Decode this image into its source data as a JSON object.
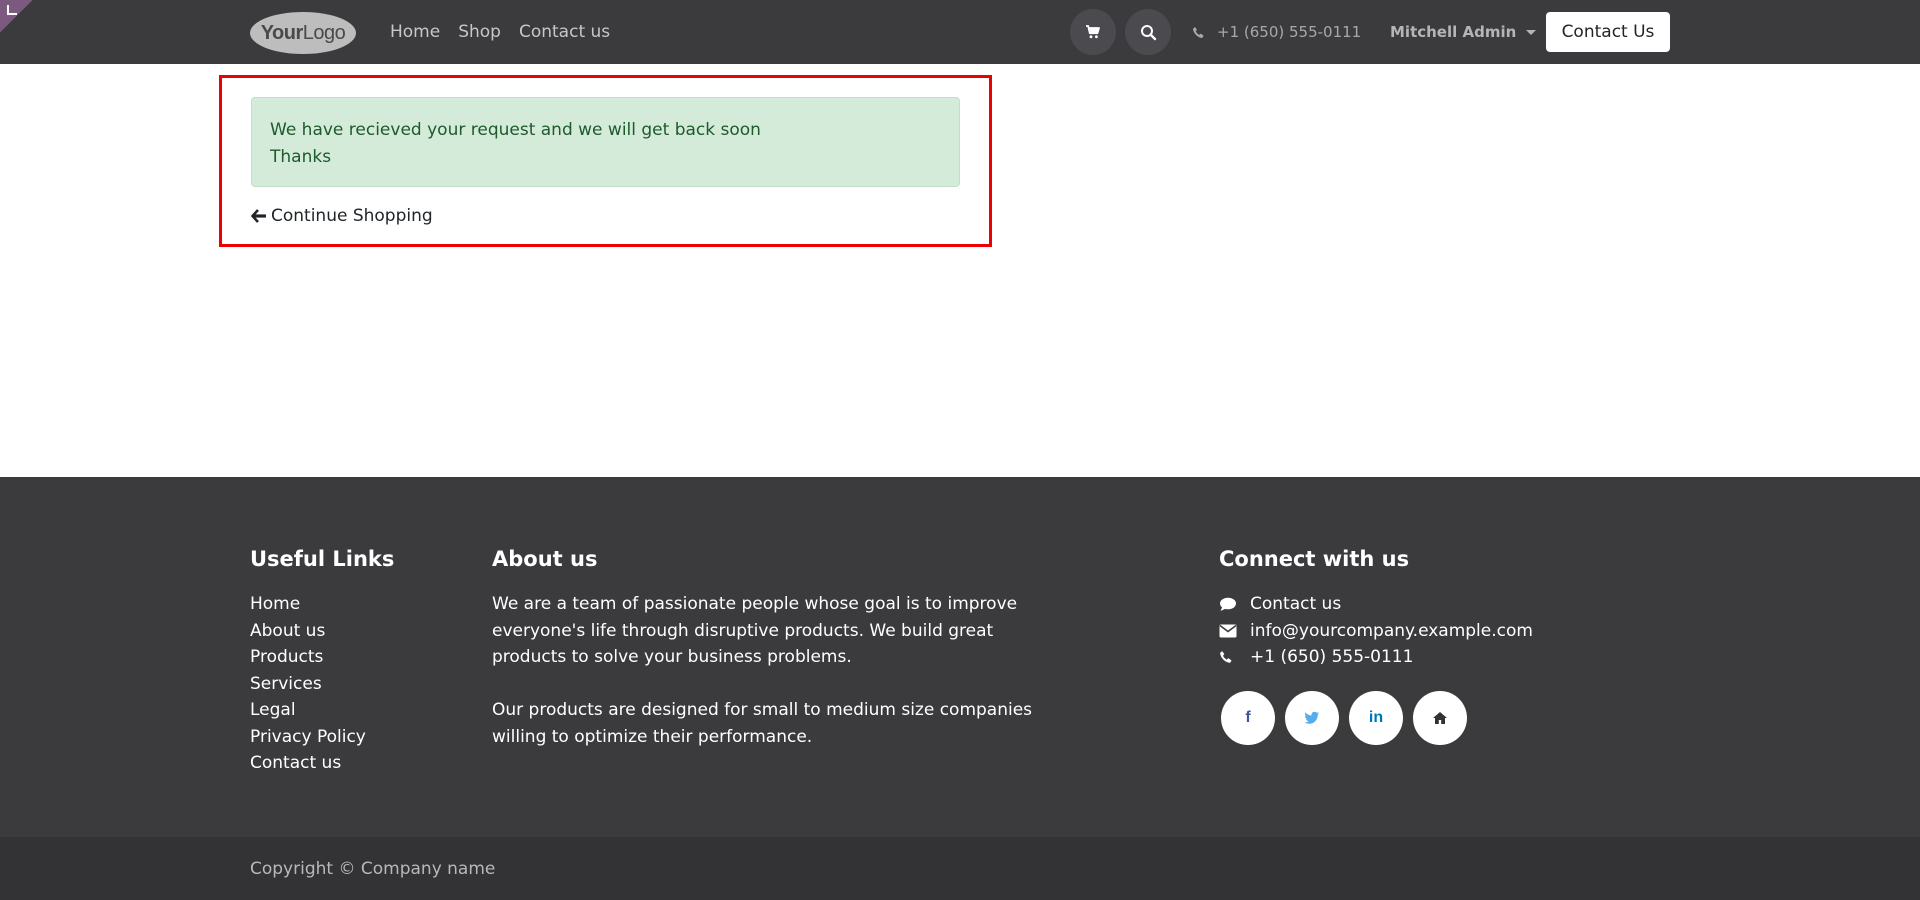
{
  "header": {
    "logo": {
      "part1": "Your",
      "part2": "Logo"
    },
    "nav": [
      {
        "label": "Home"
      },
      {
        "label": "Shop"
      },
      {
        "label": "Contact us"
      }
    ],
    "phone": "+1 (650) 555-0111",
    "user": "Mitchell Admin",
    "cta_label": "Contact Us"
  },
  "main": {
    "alert_line1": "We have recieved your request and we will get back soon",
    "alert_line2": "Thanks",
    "continue_label": "Continue Shopping"
  },
  "footer": {
    "useful_links_title": "Useful Links",
    "useful_links": [
      "Home",
      "About us",
      "Products",
      "Services",
      "Legal",
      "Privacy Policy",
      "Contact us"
    ],
    "about_title": "About us",
    "about_p1": "We are a team of passionate people whose goal is to improve everyone's life through disruptive products. We build great products to solve your business problems.",
    "about_p2": "Our products are designed for small to medium size companies willing to optimize their performance.",
    "connect_title": "Connect with us",
    "connect": {
      "contact": "Contact us",
      "email": "info@yourcompany.example.com",
      "phone": "+1 (650) 555-0111"
    },
    "social": [
      {
        "icon": "facebook-icon",
        "glyph": "f",
        "color": "#3b5998"
      },
      {
        "icon": "twitter-icon",
        "glyph": "🐦",
        "color": "#55acee"
      },
      {
        "icon": "linkedin-icon",
        "glyph": "in",
        "color": "#0077b5"
      },
      {
        "icon": "home-icon",
        "glyph": "⌂",
        "color": "#333333"
      }
    ],
    "copyright": "Copyright © Company name"
  },
  "colors": {
    "header_bg": "#3b3b3e",
    "alert_bg": "#d4ebd9",
    "alert_text": "#1e5a2c",
    "highlight_border": "#ee0000"
  }
}
